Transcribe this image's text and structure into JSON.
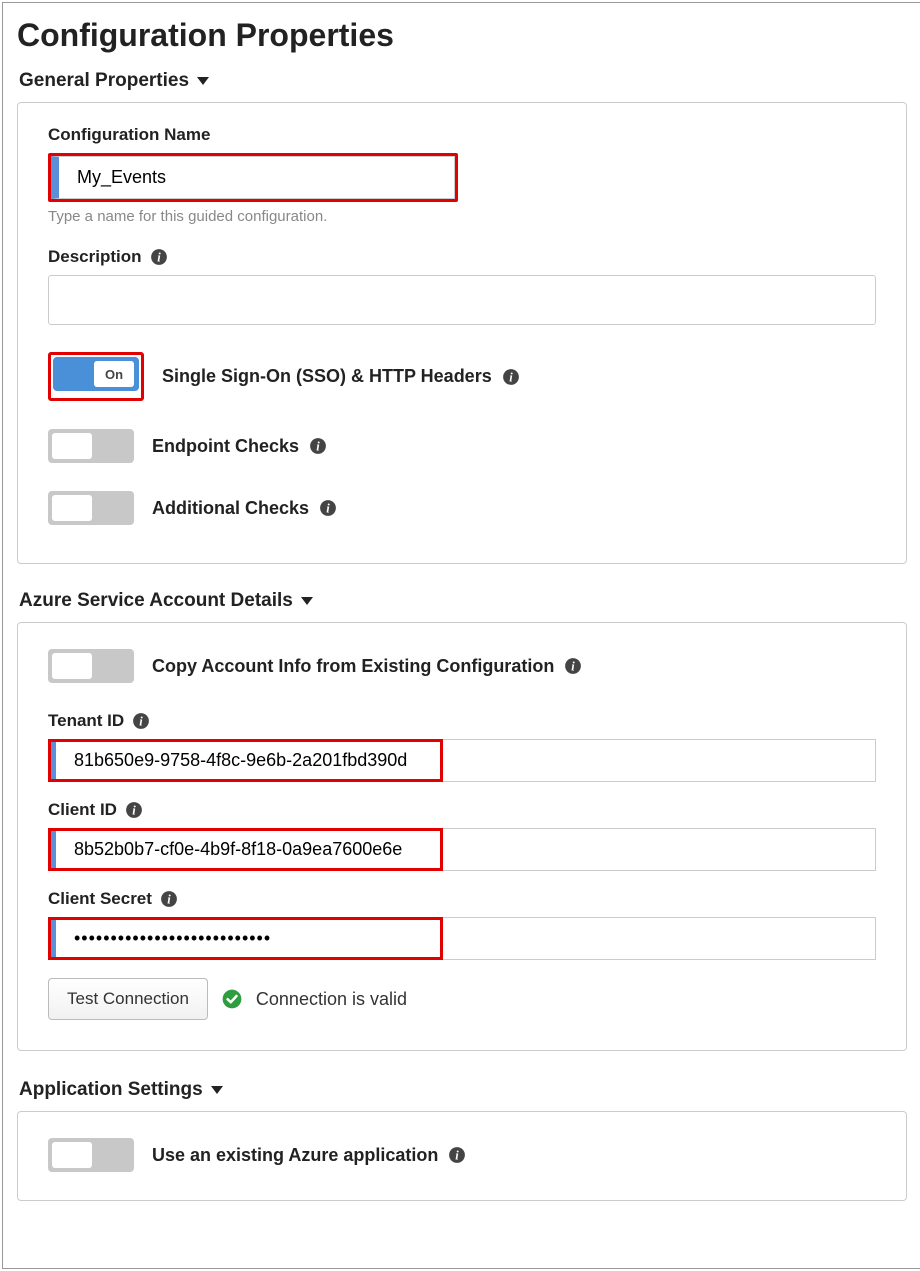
{
  "pageTitle": "Configuration Properties",
  "sections": {
    "general": {
      "header": "General Properties",
      "configName": {
        "label": "Configuration Name",
        "value": "My_Events",
        "helper": "Type a name for this guided configuration."
      },
      "description": {
        "label": "Description",
        "value": ""
      },
      "toggles": {
        "sso": {
          "label": "Single Sign-On (SSO) & HTTP Headers",
          "state": "On"
        },
        "endpoint": {
          "label": "Endpoint Checks",
          "state": "Off"
        },
        "additional": {
          "label": "Additional Checks",
          "state": "Off"
        }
      }
    },
    "azure": {
      "header": "Azure Service Account Details",
      "copyToggle": {
        "label": "Copy Account Info from Existing Configuration",
        "state": "Off"
      },
      "tenantId": {
        "label": "Tenant ID",
        "value": "81b650e9-9758-4f8c-9e6b-2a201fbd390d"
      },
      "clientId": {
        "label": "Client ID",
        "value": "8b52b0b7-cf0e-4b9f-8f18-0a9ea7600e6e"
      },
      "clientSecret": {
        "label": "Client Secret",
        "value": "•••••••••••••••••••••••••••"
      },
      "testBtn": "Test Connection",
      "connStatus": "Connection is valid"
    },
    "appSettings": {
      "header": "Application Settings",
      "useExisting": {
        "label": "Use an existing Azure application",
        "state": "Off"
      }
    }
  }
}
